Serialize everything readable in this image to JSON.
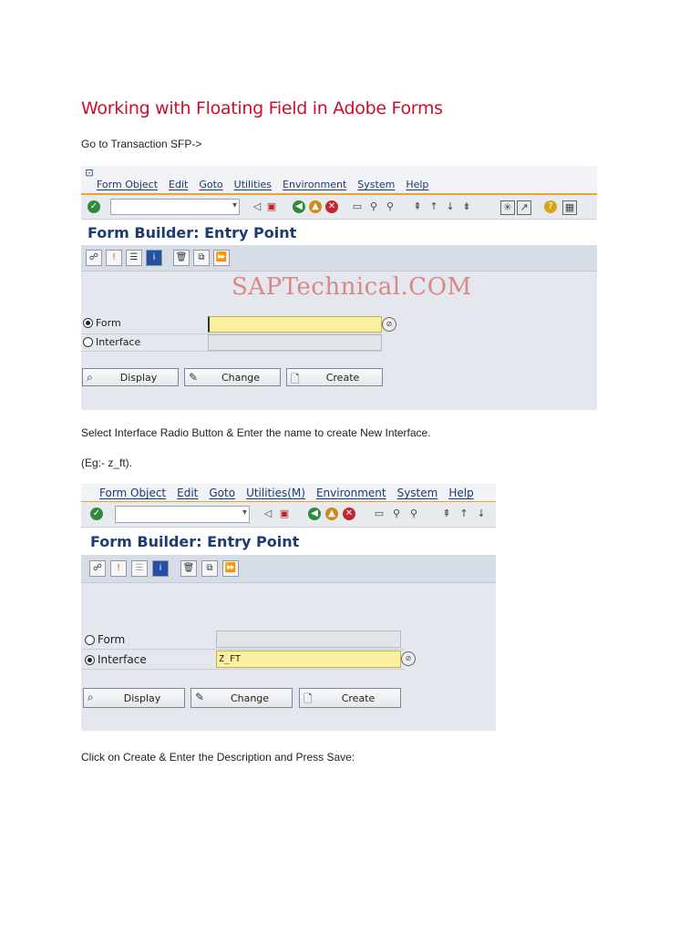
{
  "doc": {
    "title": "Working with Floating Field in Adobe Forms",
    "step1": "Go to Transaction SFP->",
    "step2": "Select Interface Radio Button & Enter the name to create New Interface.",
    "step3": "(Eg:- z_ft).",
    "step4": "Click on Create & Enter the Description and Press Save:"
  },
  "shot1": {
    "menu": [
      "Form Object",
      "Edit",
      "Goto",
      "Utilities",
      "Environment",
      "System",
      "Help"
    ],
    "screen_title": "Form Builder: Entry Point",
    "watermark": "SAPTechnical.COM",
    "radio_form": "Form",
    "radio_interface": "Interface",
    "selected": "Form",
    "form_value": "",
    "interface_value": "",
    "buttons": {
      "display": "Display",
      "change": "Change",
      "create": "Create"
    }
  },
  "shot2": {
    "menu": [
      "Form Object",
      "Edit",
      "Goto",
      "Utilities(M)",
      "Environment",
      "System",
      "Help"
    ],
    "screen_title": "Form Builder: Entry Point",
    "radio_form": "Form",
    "radio_interface": "Interface",
    "selected": "Interface",
    "form_value": "",
    "interface_value": "Z_FT",
    "buttons": {
      "display": "Display",
      "change": "Change",
      "create": "Create"
    }
  },
  "colors": {
    "title": "#c8102e",
    "sap_title": "#1d3c70",
    "accent_line": "#f0a030",
    "input_yellow": "#faf0a0"
  }
}
